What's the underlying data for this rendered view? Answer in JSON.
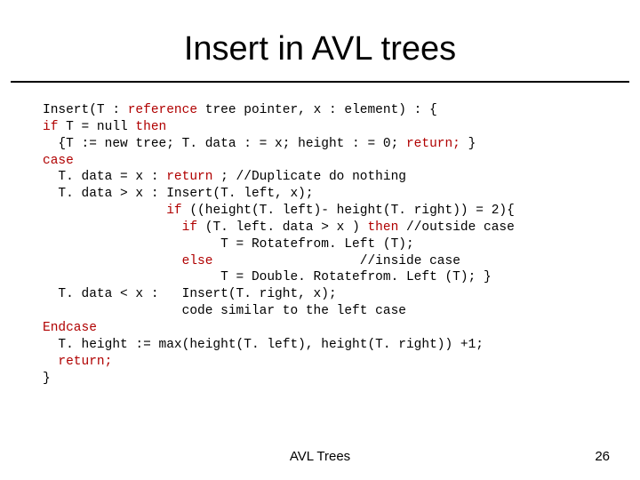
{
  "title": "Insert in AVL trees",
  "footer": {
    "center": "AVL Trees",
    "page": "26"
  },
  "code": {
    "l01a": "Insert(T : ",
    "l01b": "reference",
    "l01c": " tree pointer, x : element) : {",
    "l02a": "if",
    "l02b": " T = null ",
    "l02c": "then",
    "l03a": "  {T := new tree; T. data : = x; height : = 0; ",
    "l03b": "return;",
    "l03c": " }",
    "l04": "case",
    "l05a": "  T. data = x : ",
    "l05b": "return",
    "l05c": " ; //Duplicate do nothing",
    "l06": "  T. data > x : Insert(T. left, x);",
    "l07a": "                ",
    "l07b": "if",
    "l07c": " ((height(T. left)- height(T. right)) = 2){",
    "l08a": "                  ",
    "l08b": "if",
    "l08c": " (T. left. data > x ) ",
    "l08d": "then",
    "l08e": " //outside case",
    "l09": "                       T = Rotatefrom. Left (T);",
    "l10a": "                  ",
    "l10b": "else",
    "l10c": "                   //inside case",
    "l11": "                       T = Double. Rotatefrom. Left (T); }",
    "l12": "  T. data < x :   Insert(T. right, x);",
    "l13": "                  code similar to the left case",
    "l14": "Endcase",
    "l15": "  T. height := max(height(T. left), height(T. right)) +1;",
    "l16a": "  ",
    "l16b": "return;",
    "l17": "}"
  }
}
